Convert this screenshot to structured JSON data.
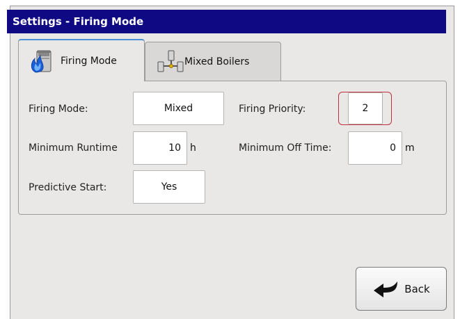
{
  "window": {
    "title": "Settings - Firing Mode"
  },
  "tabs": [
    {
      "label": "Firing Mode",
      "icon": "boiler-flame-icon",
      "active": true
    },
    {
      "label": "Mixed Boilers",
      "icon": "connected-boilers-icon",
      "active": false
    }
  ],
  "fields": {
    "firing_mode": {
      "label": "Firing Mode:",
      "value": "Mixed"
    },
    "firing_priority": {
      "label": "Firing Priority:",
      "value": "2"
    },
    "minimum_runtime": {
      "label": "Minimum Runtime",
      "value": "10",
      "unit": "h"
    },
    "minimum_off_time": {
      "label": "Minimum Off Time:",
      "value": "0",
      "unit": "m"
    },
    "predictive_start": {
      "label": "Predictive Start:",
      "value": "Yes"
    }
  },
  "buttons": {
    "back_label": "Back",
    "back_icon": "return-arrow-icon"
  },
  "colors": {
    "titlebar": "#0f0a84",
    "focus_ring": "#c0303a",
    "tab_accent": "#4a90d9"
  }
}
